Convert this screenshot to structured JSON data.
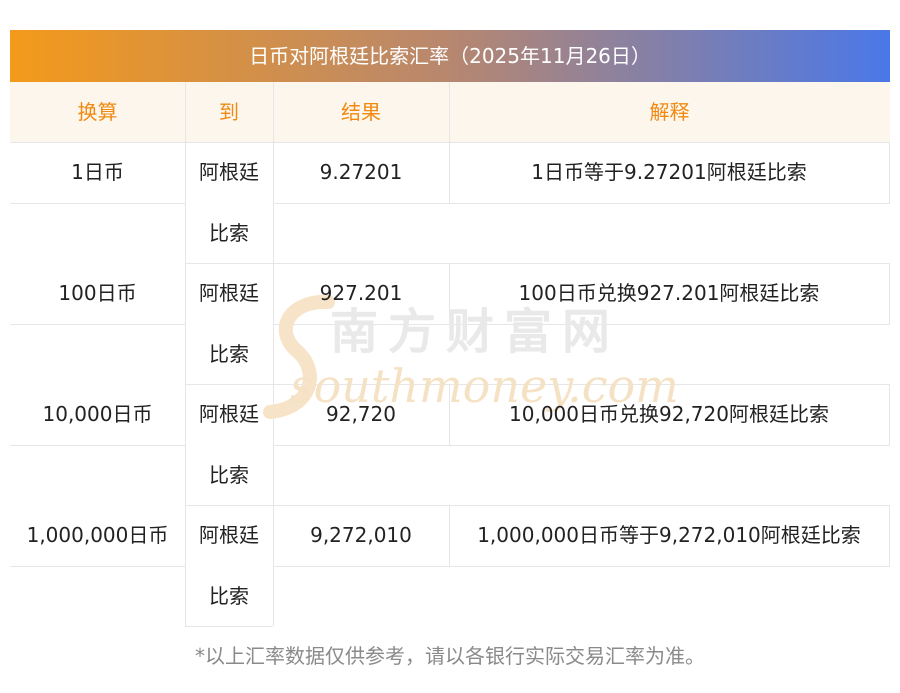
{
  "title": "日币对阿根廷比索汇率（2025年11月26日）",
  "headers": {
    "convert": "换算",
    "to": "到",
    "result": "结果",
    "explain": "解释"
  },
  "rows": [
    {
      "amount": "1日币",
      "to_line1": "阿根廷",
      "to_line2": "比索",
      "result": "9.27201",
      "explain": "1日币等于9.27201阿根廷比索"
    },
    {
      "amount": "100日币",
      "to_line1": "阿根廷",
      "to_line2": "比索",
      "result": "927.201",
      "explain": "100日币兑换927.201阿根廷比索"
    },
    {
      "amount": "10,000日币",
      "to_line1": "阿根廷",
      "to_line2": "比索",
      "result": "92,720",
      "explain": "10,000日币兑换92,720阿根廷比索"
    },
    {
      "amount": "1,000,000日币",
      "to_line1": "阿根廷",
      "to_line2": "比索",
      "result": "9,272,010",
      "explain": "1,000,000日币等于9,272,010阿根廷比索"
    }
  ],
  "watermark": {
    "cn": "南方财富网",
    "en": "southmoney.com"
  },
  "footnote": "*以上汇率数据仅供参考，请以各银行实际交易汇率为准。"
}
